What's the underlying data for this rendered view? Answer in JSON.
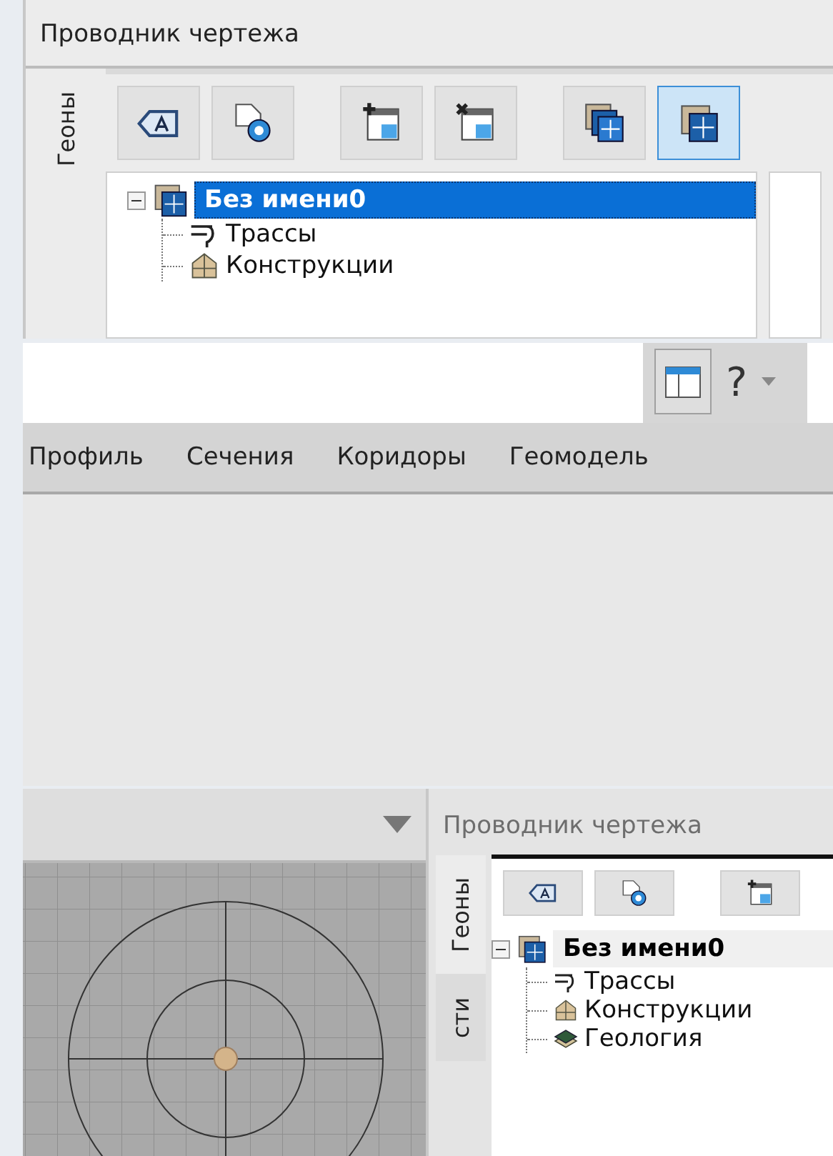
{
  "top_panel": {
    "title": "Проводник чертежа",
    "side_tab": "Геоны",
    "toolbar": [
      {
        "kind": "label",
        "selected": false
      },
      {
        "kind": "settings",
        "selected": false
      },
      {
        "kind": "add",
        "selected": false
      },
      {
        "kind": "remove",
        "selected": false
      },
      {
        "kind": "layers",
        "selected": false
      },
      {
        "kind": "layer",
        "selected": true
      }
    ],
    "tree": {
      "label": "Без имени0",
      "selected": true,
      "expanded": true,
      "children": [
        {
          "label": "Трассы",
          "kind": "routes"
        },
        {
          "label": "Конструкции",
          "kind": "structures"
        }
      ]
    }
  },
  "ribbon": {
    "help": "?",
    "menu": [
      {
        "label": "Профиль"
      },
      {
        "label": "Сечения"
      },
      {
        "label": "Коридоры"
      },
      {
        "label": "Геомодель"
      }
    ]
  },
  "bottom_panel": {
    "title": "Проводник чертежа",
    "side_tabs": [
      "Геоны",
      "сти"
    ],
    "toolbar": [
      {
        "kind": "label",
        "selected": false
      },
      {
        "kind": "settings",
        "selected": false
      },
      {
        "kind": "add",
        "selected": false
      }
    ],
    "tree": {
      "label": "Без имени0",
      "selected": false,
      "expanded": true,
      "children": [
        {
          "label": "Трассы",
          "kind": "routes"
        },
        {
          "label": "Конструкции",
          "kind": "structures"
        },
        {
          "label": "Геология",
          "kind": "geology"
        }
      ]
    }
  }
}
